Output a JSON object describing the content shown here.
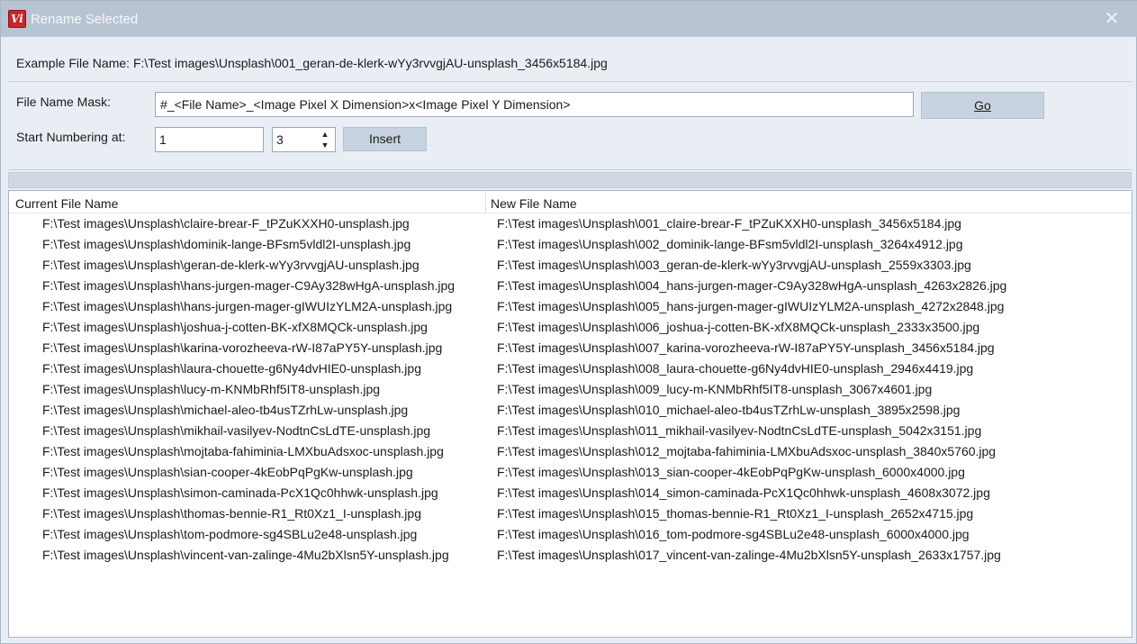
{
  "window": {
    "title": "Rename Selected",
    "icon_text": "Vi",
    "close_glyph": "✕"
  },
  "example": {
    "label": "Example File Name:",
    "value": "F:\\Test images\\Unsplash\\001_geran-de-klerk-wYy3rvvgjAU-unsplash_3456x5184.jpg"
  },
  "mask": {
    "label": "File Name Mask:",
    "value": "#_<File Name>_<Image Pixel X Dimension>x<Image Pixel Y Dimension>",
    "go_label": "Go"
  },
  "numbering": {
    "label": "Start Numbering at:",
    "start_value": "1",
    "digits_value": "3",
    "up_glyph": "▲",
    "down_glyph": "▼",
    "insert_label": "Insert"
  },
  "progress": {
    "value": 0
  },
  "list": {
    "columns": [
      "Current File Name",
      "New File Name"
    ],
    "rows": [
      [
        "F:\\Test images\\Unsplash\\claire-brear-F_tPZuKXXH0-unsplash.jpg",
        "F:\\Test images\\Unsplash\\001_claire-brear-F_tPZuKXXH0-unsplash_3456x5184.jpg"
      ],
      [
        "F:\\Test images\\Unsplash\\dominik-lange-BFsm5vldl2I-unsplash.jpg",
        "F:\\Test images\\Unsplash\\002_dominik-lange-BFsm5vldl2I-unsplash_3264x4912.jpg"
      ],
      [
        "F:\\Test images\\Unsplash\\geran-de-klerk-wYy3rvvgjAU-unsplash.jpg",
        "F:\\Test images\\Unsplash\\003_geran-de-klerk-wYy3rvvgjAU-unsplash_2559x3303.jpg"
      ],
      [
        "F:\\Test images\\Unsplash\\hans-jurgen-mager-C9Ay328wHgA-unsplash.jpg",
        "F:\\Test images\\Unsplash\\004_hans-jurgen-mager-C9Ay328wHgA-unsplash_4263x2826.jpg"
      ],
      [
        "F:\\Test images\\Unsplash\\hans-jurgen-mager-gIWUIzYLM2A-unsplash.jpg",
        "F:\\Test images\\Unsplash\\005_hans-jurgen-mager-gIWUIzYLM2A-unsplash_4272x2848.jpg"
      ],
      [
        "F:\\Test images\\Unsplash\\joshua-j-cotten-BK-xfX8MQCk-unsplash.jpg",
        "F:\\Test images\\Unsplash\\006_joshua-j-cotten-BK-xfX8MQCk-unsplash_2333x3500.jpg"
      ],
      [
        "F:\\Test images\\Unsplash\\karina-vorozheeva-rW-I87aPY5Y-unsplash.jpg",
        "F:\\Test images\\Unsplash\\007_karina-vorozheeva-rW-I87aPY5Y-unsplash_3456x5184.jpg"
      ],
      [
        "F:\\Test images\\Unsplash\\laura-chouette-g6Ny4dvHIE0-unsplash.jpg",
        "F:\\Test images\\Unsplash\\008_laura-chouette-g6Ny4dvHIE0-unsplash_2946x4419.jpg"
      ],
      [
        "F:\\Test images\\Unsplash\\lucy-m-KNMbRhf5IT8-unsplash.jpg",
        "F:\\Test images\\Unsplash\\009_lucy-m-KNMbRhf5IT8-unsplash_3067x4601.jpg"
      ],
      [
        "F:\\Test images\\Unsplash\\michael-aleo-tb4usTZrhLw-unsplash.jpg",
        "F:\\Test images\\Unsplash\\010_michael-aleo-tb4usTZrhLw-unsplash_3895x2598.jpg"
      ],
      [
        "F:\\Test images\\Unsplash\\mikhail-vasilyev-NodtnCsLdTE-unsplash.jpg",
        "F:\\Test images\\Unsplash\\011_mikhail-vasilyev-NodtnCsLdTE-unsplash_5042x3151.jpg"
      ],
      [
        "F:\\Test images\\Unsplash\\mojtaba-fahiminia-LMXbuAdsxoc-unsplash.jpg",
        "F:\\Test images\\Unsplash\\012_mojtaba-fahiminia-LMXbuAdsxoc-unsplash_3840x5760.jpg"
      ],
      [
        "F:\\Test images\\Unsplash\\sian-cooper-4kEobPqPgKw-unsplash.jpg",
        "F:\\Test images\\Unsplash\\013_sian-cooper-4kEobPqPgKw-unsplash_6000x4000.jpg"
      ],
      [
        "F:\\Test images\\Unsplash\\simon-caminada-PcX1Qc0hhwk-unsplash.jpg",
        "F:\\Test images\\Unsplash\\014_simon-caminada-PcX1Qc0hhwk-unsplash_4608x3072.jpg"
      ],
      [
        "F:\\Test images\\Unsplash\\thomas-bennie-R1_Rt0Xz1_I-unsplash.jpg",
        "F:\\Test images\\Unsplash\\015_thomas-bennie-R1_Rt0Xz1_I-unsplash_2652x4715.jpg"
      ],
      [
        "F:\\Test images\\Unsplash\\tom-podmore-sg4SBLu2e48-unsplash.jpg",
        "F:\\Test images\\Unsplash\\016_tom-podmore-sg4SBLu2e48-unsplash_6000x4000.jpg"
      ],
      [
        "F:\\Test images\\Unsplash\\vincent-van-zalinge-4Mu2bXlsn5Y-unsplash.jpg",
        "F:\\Test images\\Unsplash\\017_vincent-van-zalinge-4Mu2bXlsn5Y-unsplash_2633x1757.jpg"
      ]
    ]
  }
}
